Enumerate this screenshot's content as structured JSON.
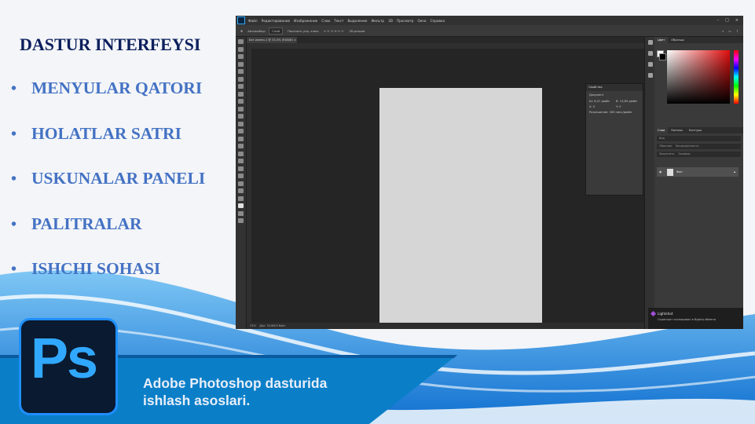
{
  "slide": {
    "title": "DASTUR INTERFEYSI",
    "bullets": [
      "MENYULAR QATORI",
      "HOLATLAR SATRI",
      "USKUNALAR PANELI",
      "PALITRALAR",
      "ISHCHI SOHASI"
    ],
    "bullet_symbol": "•",
    "banner_line1": "Adobe Photoshop dasturida",
    "banner_line2": "ishlash asoslari.",
    "logo_text": "Ps",
    "colors": {
      "title": "#0b1f5c",
      "bullets": "#4472c4",
      "banner": "#0a7fc8",
      "logo_accent": "#31a8ff"
    }
  },
  "photoshop": {
    "menu": [
      "Файл",
      "Редактирование",
      "Изображение",
      "Слои",
      "Текст",
      "Выделение",
      "Фильтр",
      "3D",
      "Просмотр",
      "Окно",
      "Справка"
    ],
    "window_controls": [
      "–",
      "□",
      "×"
    ],
    "options": {
      "autoselect": "Автовыбор:",
      "autoselect_value": "Слой",
      "transform": "Показать упр. элем.",
      "mode3d": "3D-режим"
    },
    "doc_tab": "Без имени-1 @ 33,3% (RGB/8) ×",
    "status": {
      "zoom": "33%",
      "doc": "Док: 39,6М/0 байт"
    },
    "properties_panel": {
      "title": "Свойства",
      "subtitle": "Документ",
      "w": "Ш: 8,47 дюйм",
      "h": "В: 13,69 дюйм",
      "x": "X: 0",
      "y": "Y: 0",
      "resolution": "Разрешение: 300 пикс/дюйм"
    },
    "right_panel": {
      "color_tabs": [
        "Цвет",
        "Образцы"
      ],
      "layer_tabs": [
        "Слои",
        "Каналы",
        "Контуры"
      ],
      "search": "Вид",
      "blend": "Обычные",
      "opacity": "Непрозрачность:",
      "lock": "Закрепить:",
      "fill": "Заливка:",
      "layer_name": "Фон"
    },
    "toast": {
      "title": "Lightshot",
      "subtitle": "Скриншот скопирован в буфер обмена"
    }
  }
}
